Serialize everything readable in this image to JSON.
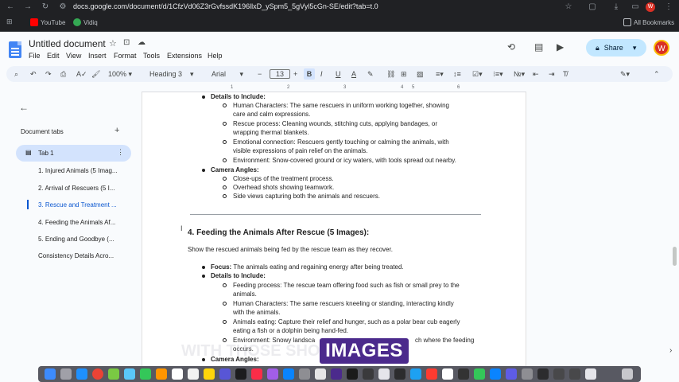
{
  "browser": {
    "url": "docs.google.com/document/d/1CfzVd06Z3rGvfssdK196llxD_ySpm5_5gVyl5cGn-SE/edit?tab=t.0",
    "bookmarks": [
      "YouTube",
      "Vidiq"
    ],
    "all_bookmarks": "All Bookmarks",
    "profile_letter": "W"
  },
  "header": {
    "title": "Untitled document",
    "menu": [
      "File",
      "Edit",
      "View",
      "Insert",
      "Format",
      "Tools",
      "Extensions",
      "Help"
    ],
    "share_label": "Share",
    "avatar_letter": "W"
  },
  "toolbar": {
    "zoom": "100%",
    "style": "Heading 3",
    "font": "Arial",
    "font_size": "13"
  },
  "sidebar": {
    "title": "Document tabs",
    "tab_label": "Tab 1",
    "items": [
      "1. Injured Animals (5 Imag...",
      "2. Arrival of Rescuers (5 I...",
      "3. Rescue and Treatment ...",
      "4. Feeding the Animals Af...",
      "5. Ending and Goodbye (...",
      "Consistency Details Acro..."
    ]
  },
  "doc": {
    "details_label": "Details to Include:",
    "prev_items": [
      "Human Characters: The same rescuers in uniform working together, showing",
      "care and calm expressions.",
      "Rescue process: Cleaning wounds, stitching cuts, applying bandages, or",
      "wrapping thermal blankets.",
      "Emotional connection: Rescuers gently touching or calming the animals, with",
      "visible expressions of pain relief on the animals.",
      "Environment: Snow-covered ground or icy waters, with tools spread out nearby."
    ],
    "camera_label": "Camera Angles:",
    "camera_items": [
      "Close-ups of the treatment process.",
      "Overhead shots showing teamwork.",
      "Side views capturing both the animals and rescuers."
    ],
    "heading": "4. Feeding the Animals After Rescue (5 Images):",
    "intro": "Show the rescued animals being fed by the rescue team as they recover.",
    "focus_label": "Focus:",
    "focus_text": "The animals eating and regaining energy after being treated.",
    "details_label2": "Details to Include:",
    "new_items": [
      "Feeding process: The rescue team offering food such as fish or small prey to the",
      "animals.",
      "Human Characters: The same rescuers kneeling or standing, interacting kindly",
      "with the animals.",
      "Animals eating: Capture their relief and hunger, such as a polar bear cub eagerly",
      "eating a fish or a dolphin being hand-fed.",
      "Environment: Snowy landsca",
      "ch where the feeding",
      "occurs."
    ],
    "camera_label2": "Camera Angles:"
  },
  "overlay": {
    "caption": "IMAGES",
    "ghost": "WITH THOSE       SHOULD"
  }
}
